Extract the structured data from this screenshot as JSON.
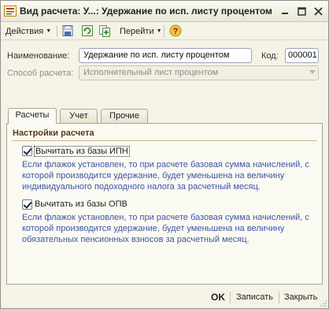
{
  "window": {
    "title": "Вид расчета: У...: Удержание по исп. листу процентом"
  },
  "toolbar": {
    "actions_label": "Действия",
    "goto_label": "Перейти",
    "icons": [
      "save-icon",
      "refresh-icon",
      "copy-icon",
      "help-icon"
    ]
  },
  "form": {
    "name_label": "Наименование:",
    "name_value": "Удержание по исп. листу процентом",
    "code_label": "Код:",
    "code_value": "000001",
    "method_label": "Способ расчета:",
    "method_value": "Исполнительный лист процентом"
  },
  "tabs": [
    {
      "label": "Расчеты"
    },
    {
      "label": "Учет"
    },
    {
      "label": "Прочие"
    }
  ],
  "settings": {
    "title": "Настройки расчета",
    "ipn_label": "Вычитать из базы ИПН",
    "ipn_checked": true,
    "ipn_desc": "Если флажок установлен, то при расчете базовая сумма начислений, с которой производится удержание, будет уменьшена на величину индивидуального подоходного налога за расчетный месяц.",
    "opv_label": "Вычитать из базы ОПВ",
    "opv_checked": true,
    "opv_desc": "Если флажок установлен, то при расчете базовая сумма начислений, с которой производится удержание, будет уменьшена на величину обязательных пенсионных взносов за расчетный месяц."
  },
  "footer": {
    "ok_label": "OK",
    "save_label": "Записать",
    "close_label": "Закрыть"
  },
  "colors": {
    "accent_text": "#3b55a8",
    "section_title": "#5a3a10",
    "window_bg": "#f5f3e6"
  }
}
